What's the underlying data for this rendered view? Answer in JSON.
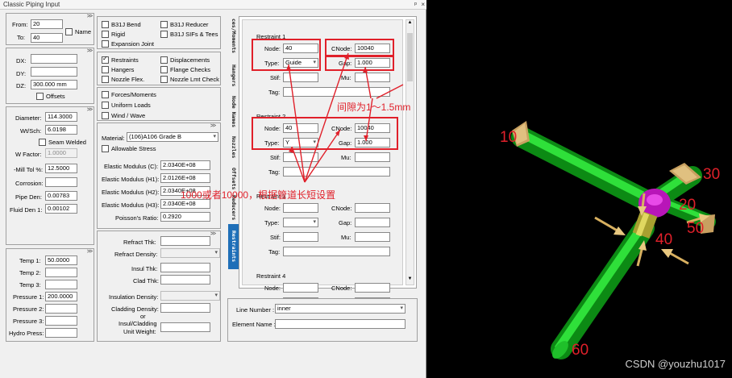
{
  "title": "Classic Piping Input",
  "title_controls": {
    "pin": "ᵖ",
    "close": "×"
  },
  "chevron": ">>",
  "colA": {
    "from_label": "From:",
    "from_value": "20",
    "to_label": "To:",
    "to_value": "40",
    "name_label": "Name",
    "dx_label": "DX:",
    "dx_value": "",
    "dy_label": "DY:",
    "dy_value": "",
    "dz_label": "DZ:",
    "dz_value": "300.000 mm",
    "offsets_label": "Offsets",
    "diameter_label": "Diameter:",
    "diameter_value": "114.3000",
    "wtsch_label": "Wt/Sch:",
    "wtsch_value": "6.0198",
    "seam_label": "Seam Welded",
    "wifactor_label": "W Factor:",
    "wifactor_value": "1.0000",
    "milltol_label": "-Mill Tol %:",
    "milltol_value": "12.5000",
    "corrosion_label": "Corrosion:",
    "corrosion_value": "",
    "pipeden_label": "Pipe Den:",
    "pipeden_value": "0.00783",
    "fluidden_label": "Fluid Den 1:",
    "fluidden_value": "0.00102",
    "temp1_label": "Temp 1:",
    "temp1_value": "50.0000",
    "temp2_label": "Temp 2:",
    "temp2_value": "",
    "temp3_label": "Temp 3:",
    "temp3_value": "",
    "press1_label": "Pressure 1:",
    "press1_value": "200.0000",
    "press2_label": "Pressure 2:",
    "press2_value": "",
    "press3_label": "Pressure 3:",
    "press3_value": "",
    "hydro_label": "Hydro Press:",
    "hydro_value": ""
  },
  "colB": {
    "b31j_bend": "B31J Bend",
    "b31j_reducer": "B31J Reducer",
    "rigid": "Rigid",
    "b31j_sifs": "B31J SIFs & Tees",
    "expansion_joint": "Expansion Joint",
    "restraints": "Restraints",
    "displacements": "Displacements",
    "hangers": "Hangers",
    "flange_checks": "Flange Checks",
    "nozzle_flex": "Nozzle Flex.",
    "nozzle_lmt": "Nozzle Lmt Check",
    "forces_moments": "Forces/Moments",
    "uniform_loads": "Uniform Loads",
    "wind_wave": "Wind / Wave",
    "material_label": "Material:",
    "material_value": "(106)A106 Grade B",
    "allowable_stress": "Allowable Stress",
    "em_c_label": "Elastic Modulus (C):",
    "em_c_value": "2.0340E+08",
    "em_h1_label": "Elastic Modulus (H1):",
    "em_h1_value": "2.0126E+08",
    "em_h2_label": "Elastic Modulus (H2):",
    "em_h2_value": "2.0340E+08",
    "em_h3_label": "Elastic Modulus (H3):",
    "em_h3_value": "2.0340E+08",
    "poisson_label": "Poisson's Ratio:",
    "poisson_value": "0.2920",
    "refract_thk_label": "Refract Thk:",
    "refract_den_label": "Refract Density:",
    "insul_thk_label": "Insul Thk:",
    "clad_thk_label": "Clad Thk:",
    "insul_den_label": "Insulation Density:",
    "clad_den_label": "Cladding Density:",
    "or_label": "or",
    "insul_clad_label": "Insul/Cladding",
    "unit_weight_label": "Unit Weight:"
  },
  "tabs": [
    "ces/Moments",
    "Hangers",
    "Node Names",
    "Nozzles",
    "Offsets",
    "Reducers",
    "Restraints"
  ],
  "restraints": [
    {
      "heading": "Restraint 1",
      "node": "40",
      "cnode": "10040",
      "type": "Guide",
      "gap": "1.000",
      "stif": "",
      "mu": "",
      "tag": ""
    },
    {
      "heading": "Restraint 2",
      "node": "40",
      "cnode": "10040",
      "type": "Y",
      "gap": "1.000",
      "stif": "",
      "mu": "",
      "tag": ""
    },
    {
      "heading": "Restraint 3",
      "node": "",
      "cnode": "",
      "type": "",
      "gap": "",
      "stif": "",
      "mu": "",
      "tag": ""
    },
    {
      "heading": "Restraint 4",
      "node": "",
      "cnode": "",
      "type": "",
      "gap": "",
      "stif": "",
      "mu": "",
      "tag": ""
    }
  ],
  "rlabels": {
    "node": "Node:",
    "cnode": "CNode:",
    "type": "Type:",
    "gap": "Gap:",
    "stif": "Stif:",
    "mu": "Mu:",
    "tag": "Tag:"
  },
  "line_number_label": "Line Number :",
  "line_number_value": "inner",
  "element_name_label": "Element Name :",
  "element_name_value": "",
  "annotations": {
    "gap": "间隙为1～1.5mm",
    "cnode": "1000或者10000，根据管道长短设置"
  },
  "model": {
    "nodes": [
      "10",
      "20",
      "30",
      "40",
      "50",
      "60"
    ],
    "pipe_color": "#19c21f",
    "fitting_color": "#d21fd2",
    "restraint_color": "#e0c070"
  },
  "watermark": "CSDN @youzhu1017"
}
